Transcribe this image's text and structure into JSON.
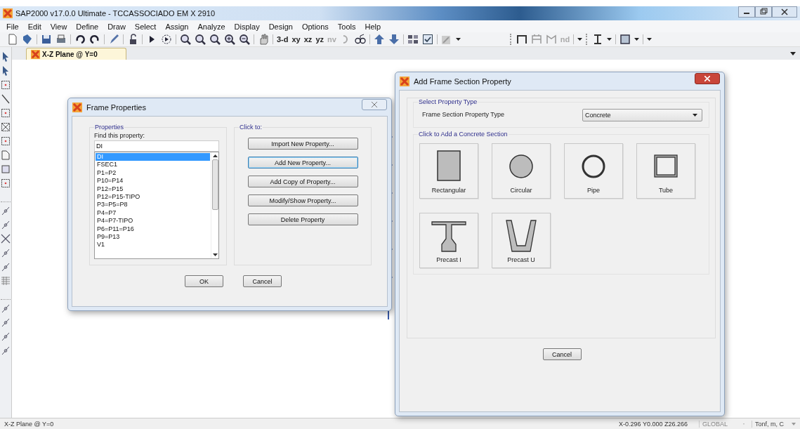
{
  "window": {
    "title": "SAP2000 v17.0.0 Ultimate  - TCCASSOCIADO EM  X 2910"
  },
  "menu": [
    "File",
    "Edit",
    "View",
    "Define",
    "Draw",
    "Select",
    "Assign",
    "Analyze",
    "Display",
    "Design",
    "Options",
    "Tools",
    "Help"
  ],
  "toolbar_views": [
    {
      "label": "3-d",
      "disabled": false
    },
    {
      "label": "xy",
      "disabled": false
    },
    {
      "label": "xz",
      "disabled": false
    },
    {
      "label": "yz",
      "disabled": false
    },
    {
      "label": "nv",
      "disabled": true
    }
  ],
  "toolbar_nd": {
    "label": "nd",
    "disabled": true
  },
  "tabs": [
    {
      "label": "X-Z Plane @ Y=0",
      "selected": true
    }
  ],
  "frame_properties": {
    "title": "Frame Properties",
    "properties_group": "Properties",
    "find_label": "Find this property:",
    "find_value": "DI",
    "items": [
      {
        "label": "DI",
        "selected": true
      },
      {
        "label": "FSEC1",
        "selected": false
      },
      {
        "label": "P1=P2",
        "selected": false
      },
      {
        "label": "P10=P14",
        "selected": false
      },
      {
        "label": "P12=P15",
        "selected": false
      },
      {
        "label": "P12=P15-TIPO",
        "selected": false
      },
      {
        "label": "P3=P5=P8",
        "selected": false
      },
      {
        "label": "P4=P7",
        "selected": false
      },
      {
        "label": "P4=P7-TIPO",
        "selected": false
      },
      {
        "label": "P6=P11=P16",
        "selected": false
      },
      {
        "label": "P9=P13",
        "selected": false
      },
      {
        "label": "V1",
        "selected": false
      }
    ],
    "actions_group": "Click to:",
    "actions": [
      {
        "label": "Import New Property...",
        "focused": false
      },
      {
        "label": "Add New Property...",
        "focused": true
      },
      {
        "label": "Add Copy of Property...",
        "focused": false
      },
      {
        "label": "Modify/Show Property...",
        "focused": false
      },
      {
        "label": "Delete Property",
        "focused": false
      }
    ],
    "ok": "OK",
    "cancel": "Cancel"
  },
  "add_section": {
    "title": "Add Frame Section Property",
    "type_group": "Select Property Type",
    "type_label": "Frame Section Property Type",
    "type_value": "Concrete",
    "sections_group": "Click to Add a Concrete Section",
    "sections": [
      {
        "label": "Rectangular",
        "kind": "rectangular"
      },
      {
        "label": "Circular",
        "kind": "circular"
      },
      {
        "label": "Pipe",
        "kind": "pipe"
      },
      {
        "label": "Tube",
        "kind": "tube"
      },
      {
        "label": "Precast I",
        "kind": "precast_i"
      },
      {
        "label": "Precast U",
        "kind": "precast_u"
      }
    ],
    "cancel": "Cancel"
  },
  "status_bar": {
    "view": "X-Z Plane @ Y=0",
    "coordinates": "X-0.296  Y0.000  Z26.266",
    "coordinate_system": "GLOBAL",
    "units": "Tonf, m, C"
  }
}
